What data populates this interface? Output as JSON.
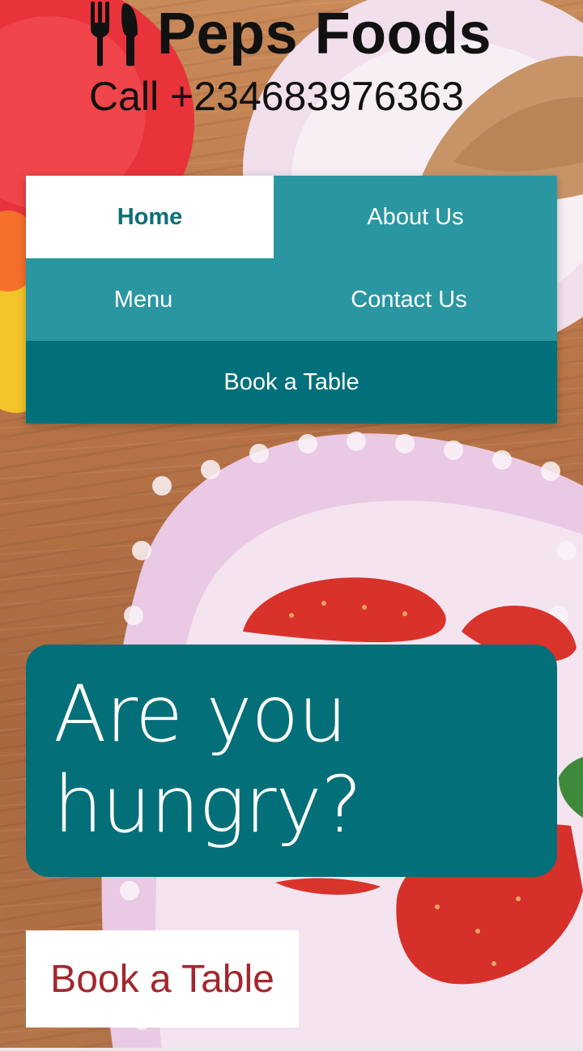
{
  "header": {
    "brand_icon": "utensils-icon",
    "brand_name": "Peps Foods",
    "phone": "Call +234683976363"
  },
  "nav": {
    "items": [
      {
        "label": "Home",
        "active": true
      },
      {
        "label": "About Us",
        "active": false
      },
      {
        "label": "Menu",
        "active": false
      },
      {
        "label": "Contact Us",
        "active": false
      },
      {
        "label": "Book a Table",
        "active": false
      }
    ]
  },
  "hero": {
    "heading": "Are you hungry?"
  },
  "cta": {
    "label": "Book a Table"
  },
  "colors": {
    "nav_primary": "#2a96a1",
    "nav_dark": "#02707a",
    "hero_bg": "#036f79",
    "cta_text": "#a3272d",
    "active_text": "#0e6f76"
  }
}
